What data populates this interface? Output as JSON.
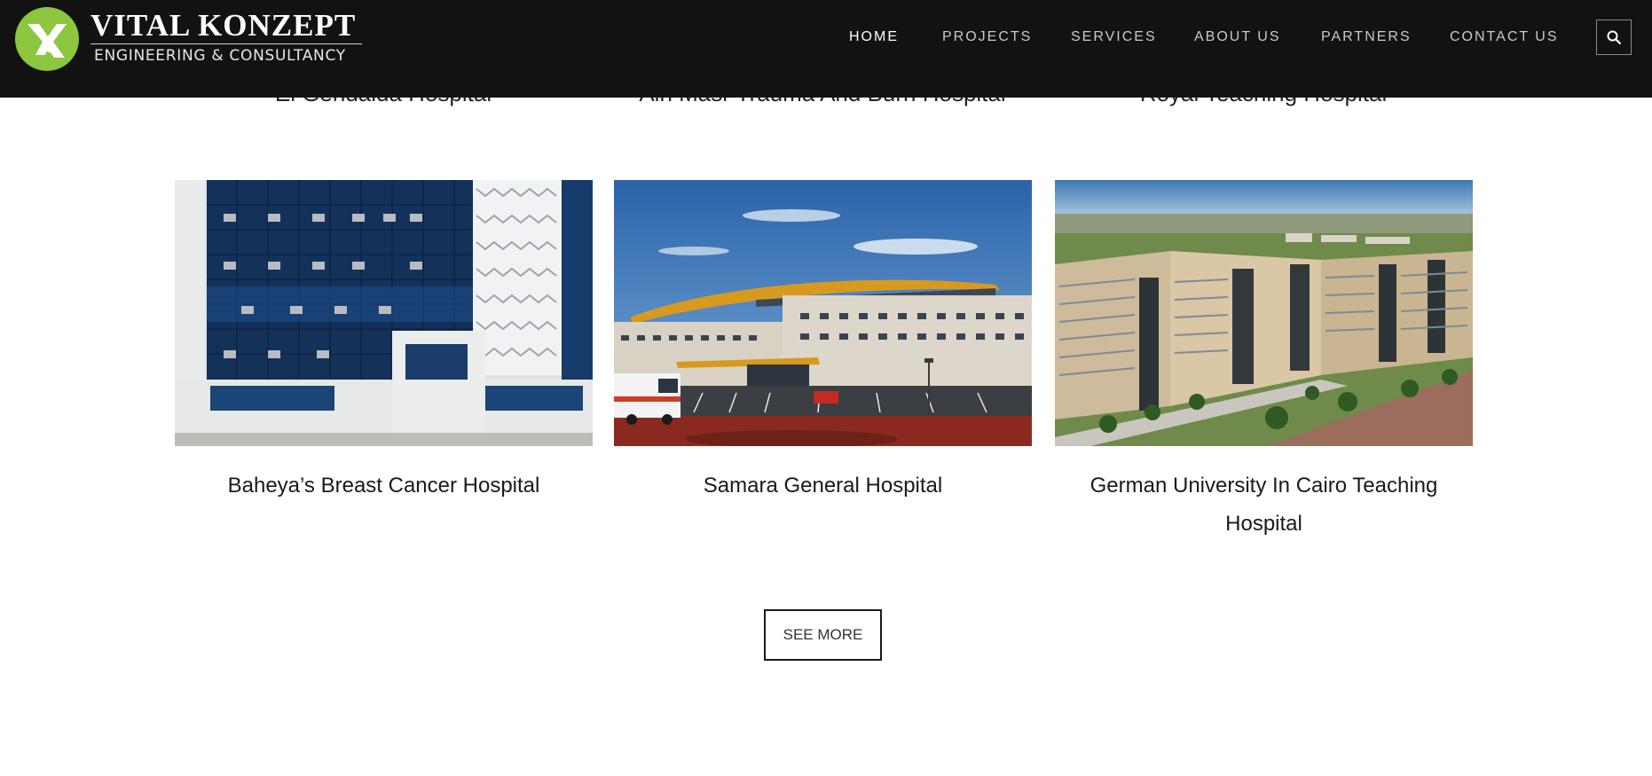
{
  "brand": {
    "name": "VITAL KONZEPT",
    "tagline": "ENGINEERING & CONSULTANCY",
    "accent": "#8dc63f"
  },
  "nav": {
    "items": [
      {
        "label": "HOME",
        "active": true
      },
      {
        "label": "PROJECTS",
        "active": false
      },
      {
        "label": "SERVICES",
        "active": false
      },
      {
        "label": "ABOUT US",
        "active": false
      },
      {
        "label": "PARTNERS",
        "active": false
      },
      {
        "label": "CONTACT US",
        "active": false
      }
    ],
    "search_icon": "search-icon"
  },
  "previous_row_captions": [
    "El Gendaida Hospital",
    "Ain Masr Trauma And Burn Hospital",
    "Royal Teaching Hospital"
  ],
  "projects": [
    {
      "title": "Baheya’s Breast Cancer Hospital"
    },
    {
      "title": "Samara General Hospital"
    },
    {
      "title": "German University In Cairo Teaching Hospital"
    }
  ],
  "see_more_label": "SEE MORE",
  "colors": {
    "header_bg": "#121212",
    "nav_active": "#ffffff",
    "nav_inactive": "#c9c9c9",
    "text": "#1a1a1a"
  }
}
